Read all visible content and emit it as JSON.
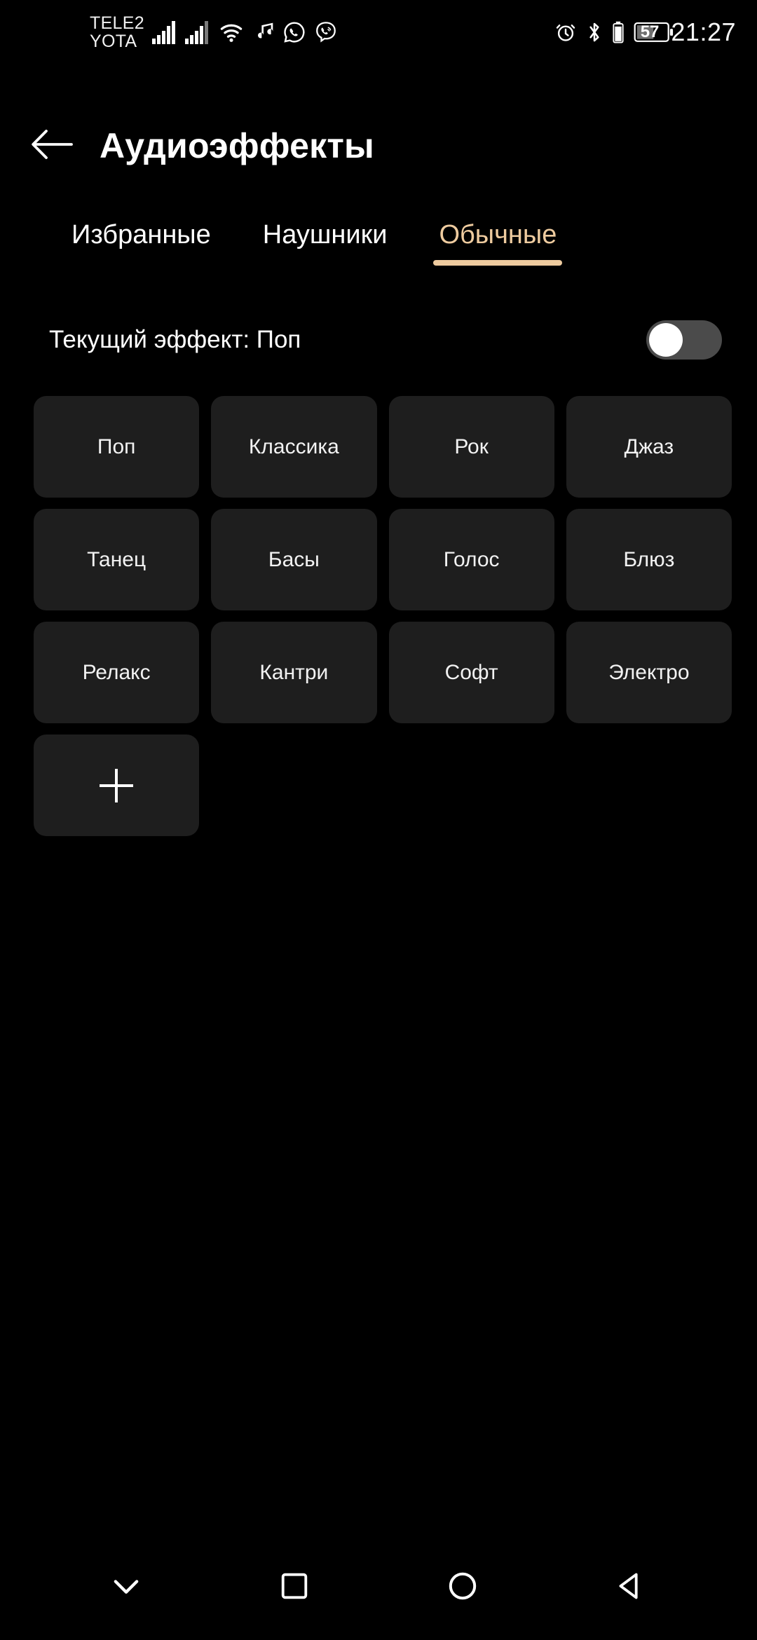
{
  "status_bar": {
    "carrier_line1": "TELE2",
    "carrier_line2": "YOTA",
    "icons": [
      "signal-sim1-icon",
      "signal-sim2-icon",
      "wifi-icon",
      "music-note-icon",
      "whatsapp-icon",
      "viber-icon"
    ],
    "alarm_icon": "alarm-icon",
    "bluetooth_icon": "bluetooth-icon",
    "secondary_battery_icon": "secondary-battery-icon",
    "battery_percent": "57",
    "time": "21:27"
  },
  "appbar": {
    "back_icon": "back-arrow-icon",
    "title": "Аудиоэффекты"
  },
  "tabs": {
    "items": [
      {
        "label": "Избранные",
        "active": false
      },
      {
        "label": "Наушники",
        "active": false
      },
      {
        "label": "Обычные",
        "active": true
      }
    ],
    "accent_color": "#eecb9f"
  },
  "current_effect": {
    "label": "Текущий эффект: Поп",
    "toggle_state": "off"
  },
  "presets": {
    "items": [
      {
        "label": "Поп"
      },
      {
        "label": "Классика"
      },
      {
        "label": "Рок"
      },
      {
        "label": "Джаз"
      },
      {
        "label": "Танец"
      },
      {
        "label": "Басы"
      },
      {
        "label": "Голос"
      },
      {
        "label": "Блюз"
      },
      {
        "label": "Релакс"
      },
      {
        "label": "Кантри"
      },
      {
        "label": "Софт"
      },
      {
        "label": "Электро"
      }
    ],
    "add_icon": "plus-icon",
    "tile_color": "#1e1e1e"
  },
  "navbar": {
    "buttons": [
      {
        "icon": "chevron-down-icon"
      },
      {
        "icon": "square-recents-icon"
      },
      {
        "icon": "circle-home-icon"
      },
      {
        "icon": "triangle-back-icon"
      }
    ]
  },
  "theme": {
    "background": "#000000",
    "accent": "#eecb9f",
    "tile": "#1e1e1e",
    "text": "#ffffff"
  }
}
